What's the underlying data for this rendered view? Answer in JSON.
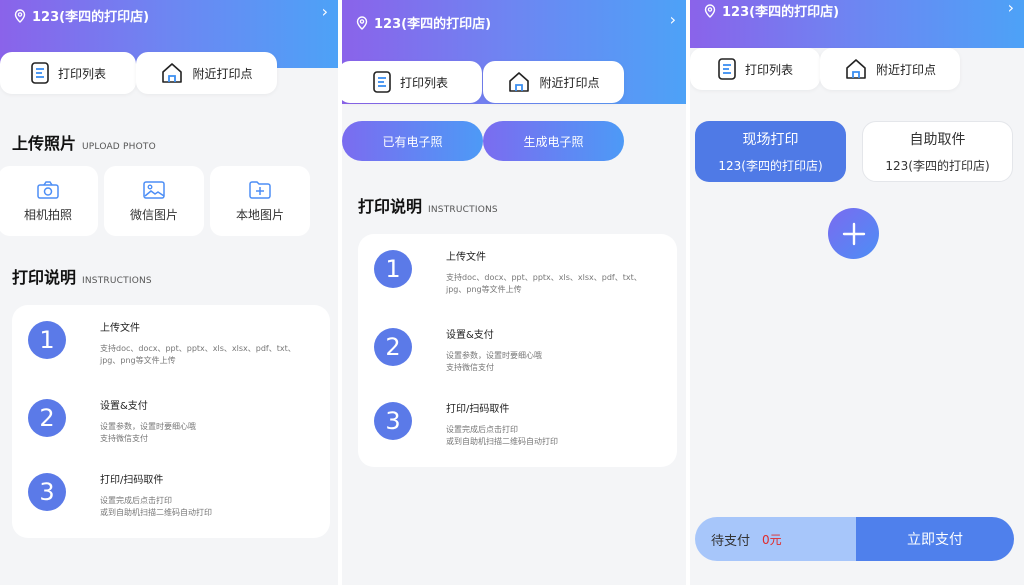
{
  "store": {
    "name": "123(李四的打印店)",
    "chevron": "›"
  },
  "nav": {
    "print_list": "打印列表",
    "nearby": "附近打印点"
  },
  "upload": {
    "title": "上传照片",
    "subtitle": "UPLOAD PHOTO",
    "options": [
      {
        "label": "相机拍照",
        "icon": "camera-icon"
      },
      {
        "label": "微信图片",
        "icon": "image-icon"
      },
      {
        "label": "本地图片",
        "icon": "folder-add-icon"
      }
    ]
  },
  "instructions": {
    "title": "打印说明",
    "subtitle": "INSTRUCTIONS",
    "steps": [
      {
        "num": "1",
        "title": "上传文件",
        "desc": "支持doc、docx、ppt、pptx、xls、xlsx、pdf、txt、jpg、png等文件上传"
      },
      {
        "num": "2",
        "title": "设置&支付",
        "desc": "设置参数，设置时要细心哦\n支持微信支付"
      },
      {
        "num": "3",
        "title": "打印/扫码取件",
        "desc": "设置完成后点击打印\n或到自助机扫描二维码自动打印"
      }
    ]
  },
  "photo_buttons": {
    "existing": "已有电子照",
    "generate": "生成电子照"
  },
  "print_modes": {
    "onsite": {
      "title": "现场打印",
      "store": "123(李四的打印店)"
    },
    "self": {
      "title": "自助取件",
      "store": "123(李四的打印店)"
    }
  },
  "payment": {
    "label": "待支付",
    "amount": "0元",
    "pay_button": "立即支付"
  },
  "colors": {
    "gradient_start": "#8a63ea",
    "gradient_end": "#4da2f7",
    "accent": "#4f80ec",
    "step_circle": "#5b7ae8",
    "amount": "#e02a2a"
  }
}
